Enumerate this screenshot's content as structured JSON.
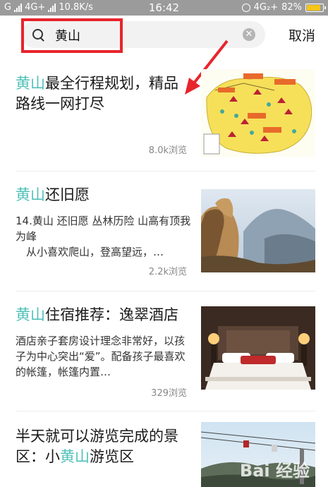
{
  "status_bar": {
    "carrier": "G",
    "network": "4G+",
    "speed": "10.8K/s",
    "time": "16:42",
    "network_right": "4G₂+",
    "battery": "82%",
    "battery_level": 0.82
  },
  "search": {
    "query": "黄山",
    "cancel_label": "取消"
  },
  "articles": [
    {
      "title_kw": "黄山",
      "title_rest": "最全行程规划，精品路线一网打尽",
      "desc": "",
      "views": "8.0k浏览",
      "thumb": "map-image"
    },
    {
      "title_kw": "黄山",
      "title_rest": "还旧愿",
      "desc": "14.黄山 还旧愿 丛林历险 山高有顶我为峰\n　从小喜欢爬山，登高望远，…",
      "views": "2.2k浏览",
      "thumb": "mountain-image"
    },
    {
      "title_kw": "黄山",
      "title_rest": "住宿推荐：逸翠酒店",
      "desc": "酒店亲子套房设计理念非常好，以孩子为中心突出“爱”。配备孩子最喜欢的帐篷，帐篷内置…",
      "views": "329浏览",
      "thumb": "hotel-room-image"
    },
    {
      "title_pre": "半天就可以游览完成的景区：小",
      "title_kw": "黄山",
      "title_rest": "游览区",
      "thumb": "cable-car-image"
    }
  ],
  "watermark": "Bai 经验"
}
